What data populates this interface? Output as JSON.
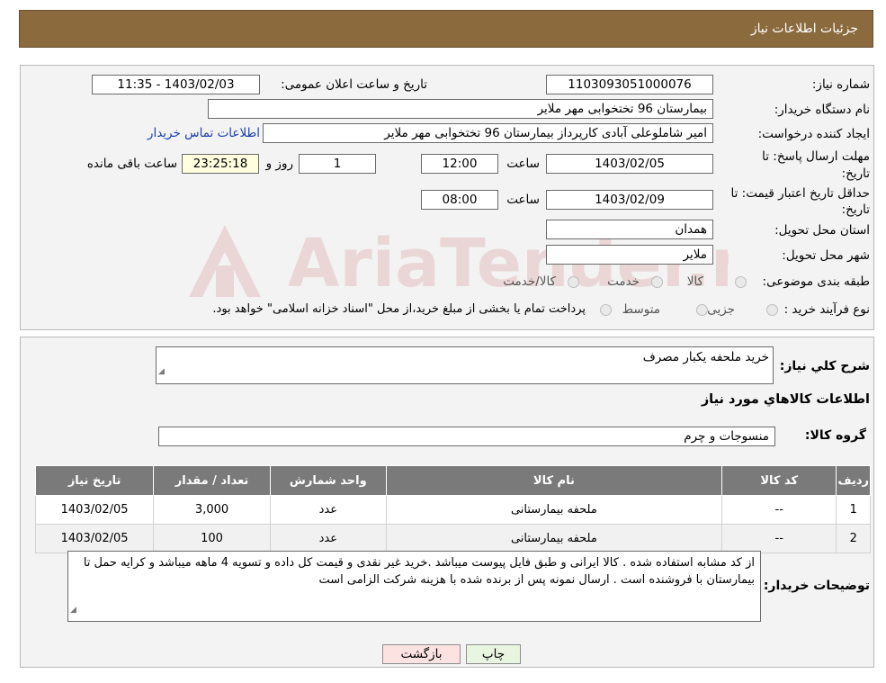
{
  "header": {
    "title": "جزئیات اطلاعات نیاز"
  },
  "details": {
    "need_number_label": "شماره نیاز:",
    "need_number": "1103093051000076",
    "announce_label": "تاریخ و ساعت اعلان عمومی:",
    "announce_value": "1403/02/03 - 11:35",
    "buyer_org_label": "نام دستگاه خریدار:",
    "buyer_org": "بیمارستان 96 تختخوابی مهر ملایر",
    "creator_label": "ایجاد کننده درخواست:",
    "creator": "امیر شاملوعلی آبادی کارپرداز بیمارستان 96 تختخوابی مهر ملایر",
    "contact_link": "اطلاعات تماس خریدار",
    "reply_deadline_label_1": "مهلت ارسال پاسخ: تا",
    "reply_deadline_label_2": "تاریخ:",
    "reply_date": "1403/02/05",
    "time_label": "ساعت",
    "reply_time": "12:00",
    "days_value": "1",
    "days_label": "روز و",
    "remaining_time": "23:25:18",
    "remaining_label": "ساعت باقی مانده",
    "validity_label_1": "حداقل تاریخ اعتبار قیمت: تا",
    "validity_label_2": "تاریخ:",
    "validity_date": "1403/02/09",
    "validity_time": "08:00",
    "province_label": "استان محل تحویل:",
    "province": "همدان",
    "city_label": "شهر محل تحویل:",
    "city": "ملایر",
    "category_label": "طبقه بندی موضوعی:",
    "category_options": [
      "کالا",
      "خدمت",
      "کالا/خدمت"
    ],
    "process_label": "نوع فرآیند خرید :",
    "process_options": [
      "جزیی",
      "متوسط"
    ],
    "process_note": "پرداخت تمام یا بخشی از مبلغ خرید،از محل \"اسناد خزانه اسلامی\" خواهد بود."
  },
  "summary": {
    "label": "شرح کلي نياز:",
    "value": "خرید ملحفه یکبار مصرف",
    "goods_info_title": "اطلاعات کالاهاي مورد نياز",
    "group_label": "گروه کالا:",
    "group_value": "منسوجات و چرم"
  },
  "table": {
    "headers": [
      "رديف",
      "کد کالا",
      "نام کالا",
      "واحد شمارش",
      "تعداد / مقدار",
      "تاریخ نیاز"
    ],
    "rows": [
      [
        "1",
        "--",
        "ملحفه بیمارستانی",
        "عدد",
        "3,000",
        "1403/02/05"
      ],
      [
        "2",
        "--",
        "ملحفه بیمارستانی",
        "عدد",
        "100",
        "1403/02/05"
      ]
    ]
  },
  "notes": {
    "label": "توضیحات خریدار:",
    "text": "از کد مشابه استفاده شده . کالا ایرانی و طبق فایل پیوست میباشد .خرید غیر نقدی و قیمت کل داده و تسویه 4 ماهه میباشد و کرایه حمل تا بیمارستان با فروشنده است . ارسال نمونه پس از برنده شده با هزینه شرکت الزامی است"
  },
  "buttons": {
    "print": "چاپ",
    "back": "بازگشت"
  },
  "watermark": {
    "text": "AriaTender.neT"
  },
  "colors": {
    "header_bg": "#8b6a3e",
    "table_header": "#7a7a7a",
    "link": "#1a3fb0",
    "remaining_bg": "#ffffe0",
    "back_btn": "#fde2e2",
    "print_btn": "#e8f5e0"
  }
}
